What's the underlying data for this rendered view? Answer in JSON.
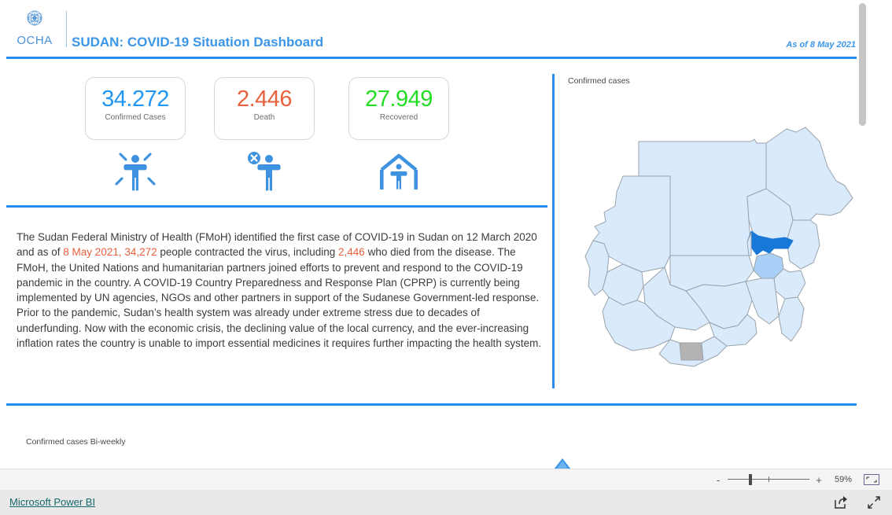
{
  "app": {
    "footer_link": "Microsoft Power BI",
    "zoom_percent": "59%",
    "zoom_minus": "-",
    "zoom_plus": "+"
  },
  "header": {
    "logo_text": "OCHA",
    "logo_icon": "un-emblem-icon",
    "title": "SUDAN: COVID-19 Situation Dashboard",
    "as_of": "As of 8 May 2021"
  },
  "kpis": [
    {
      "value": "34.272",
      "label": "Confirmed Cases",
      "color": "#2196f3",
      "icon": "person-infected-icon",
      "name": "confirmed-cases"
    },
    {
      "value": "2.446",
      "label": "Death",
      "color": "#e8613c",
      "icon": "person-deceased-icon",
      "name": "death"
    },
    {
      "value": "27.949",
      "label": "Recovered",
      "color": "#22dd22",
      "icon": "person-recovered-home-icon",
      "name": "recovered"
    }
  ],
  "narrative": {
    "p1_part1": "The Sudan Federal Ministry of Health (FMoH) identified the first case of COVID-19 in Sudan on 12 March 2020 and as of ",
    "p1_hl1": "8 May 2021, 34,272",
    "p1_part2": " people contracted the virus, including ",
    "p1_hl2": "2,446",
    "p1_part3": " who died from the disease. The FMoH, the United Nations and humanitarian partners joined efforts to prevent and respond to the COVID-19 pandemic in the country. A COVID-19 Country Preparedness and Response Plan (CPRP) is currently being implemented by UN agencies, NGOs and other partners in support of the Sudanese Government-led response.",
    "p2": "Prior to the pandemic, Sudan’s health system was already under extreme stress due to decades of underfunding. Now with the economic crisis, the declining value of the local currency, and the ever-increasing inflation rates the country is unable to import essential medicines it requires further impacting the health system."
  },
  "map": {
    "title": "Confirmed cases",
    "highlight_color": "#1878d8",
    "fill_light": "#d6e9fb",
    "fill_mid": "#a9d1f7",
    "fill_disputed": "#b3b3b3",
    "border_color": "#9aa3ab"
  },
  "bottom": {
    "chart_title": "Confirmed cases Bi-weekly",
    "scroll_up_icon": "triangle-up-icon"
  },
  "chart_data": {
    "type": "bar",
    "title": "Confirmed cases Bi-weekly",
    "categories": [],
    "values": [],
    "xlabel": "",
    "ylabel": "",
    "note": "Chart area is scrolled out of view; only the title is rendered in the screenshot."
  },
  "icons": {
    "share": "share-icon",
    "fullscreen": "fullscreen-icon",
    "fit_to_page": "fit-to-page-icon"
  }
}
